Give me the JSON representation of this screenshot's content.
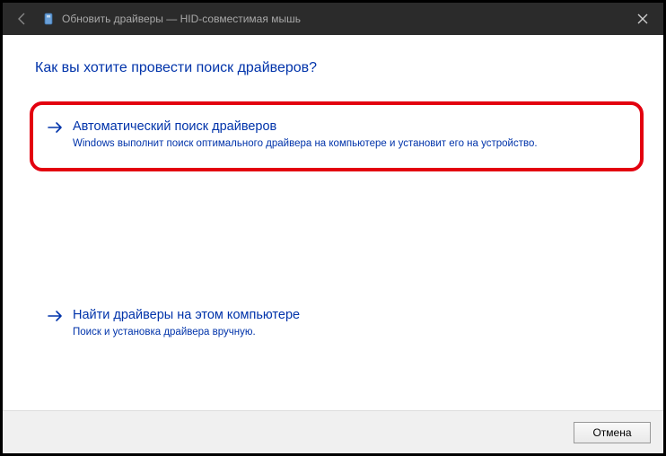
{
  "titlebar": {
    "title": "Обновить драйверы — HID-совместимая мышь"
  },
  "heading": "Как вы хотите провести поиск драйверов?",
  "options": [
    {
      "title": "Автоматический поиск драйверов",
      "desc": "Windows выполнит поиск оптимального драйвера на компьютере и установит его на устройство."
    },
    {
      "title": "Найти драйверы на этом компьютере",
      "desc": "Поиск и установка драйвера вручную."
    }
  ],
  "footer": {
    "cancel": "Отмена"
  }
}
